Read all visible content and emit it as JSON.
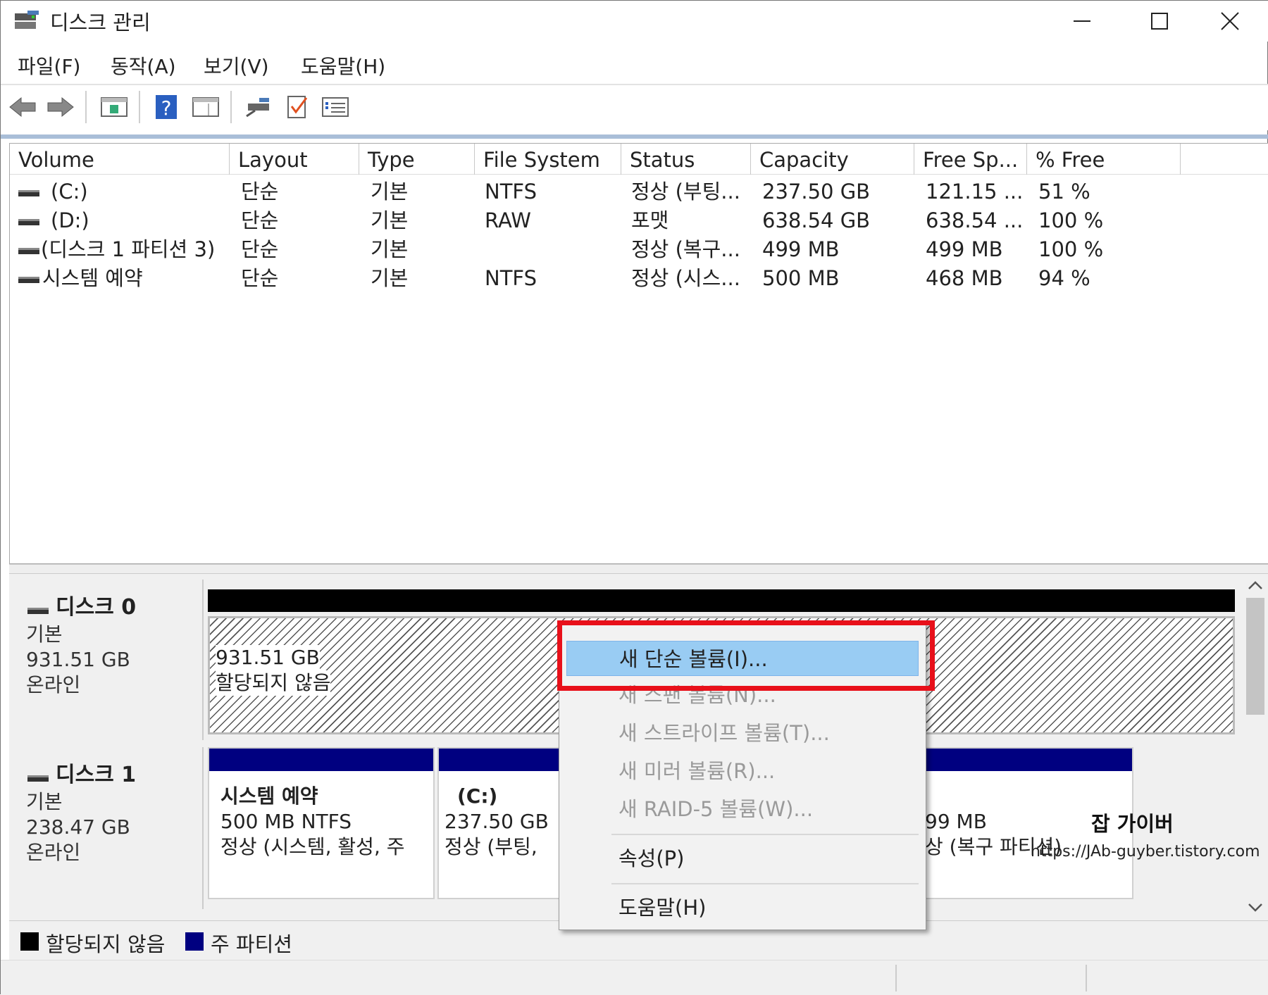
{
  "window": {
    "title": "디스크 관리"
  },
  "menubar": [
    "파일(F)",
    "동작(A)",
    "보기(V)",
    "도움말(H)"
  ],
  "volume_table": {
    "columns": [
      "Volume",
      "Layout",
      "Type",
      "File System",
      "Status",
      "Capacity",
      "Free Sp...",
      "% Free"
    ],
    "rows": [
      {
        "volume": "(C:)",
        "layout": "단순",
        "type": "기본",
        "fs": "NTFS",
        "status": "정상 (부팅...",
        "capacity": "237.50 GB",
        "free": "121.15 ...",
        "pct": "51 %"
      },
      {
        "volume": "(D:)",
        "layout": "단순",
        "type": "기본",
        "fs": "RAW",
        "status": "포맷",
        "capacity": "638.54 GB",
        "free": "638.54 ...",
        "pct": "100 %"
      },
      {
        "volume": "(디스크 1 파티션 3)",
        "layout": "단순",
        "type": "기본",
        "fs": "",
        "status": "정상 (복구...",
        "capacity": "499 MB",
        "free": "499 MB",
        "pct": "100 %"
      },
      {
        "volume": "시스템 예약",
        "layout": "단순",
        "type": "기본",
        "fs": "NTFS",
        "status": "정상 (시스...",
        "capacity": "500 MB",
        "free": "468 MB",
        "pct": "94 %"
      }
    ]
  },
  "disks": [
    {
      "name": "디스크 0",
      "type": "기본",
      "size": "931.51 GB",
      "state": "온라인",
      "partitions": [
        {
          "size": "931.51 GB",
          "desc": "할당되지 않음"
        }
      ]
    },
    {
      "name": "디스크 1",
      "type": "기본",
      "size": "238.47 GB",
      "state": "온라인",
      "partitions": [
        {
          "name": "시스템 예약",
          "size": "500 MB NTFS",
          "desc": "정상 (시스템, 활성, 주"
        },
        {
          "name": "(C:)",
          "size": "237.50 GB",
          "desc": "정상 (부팅,"
        },
        {
          "size": "99 MB",
          "desc": "상 (복구 파티션)"
        }
      ]
    }
  ],
  "legend": [
    {
      "label": "할당되지 않음",
      "color": "#000000"
    },
    {
      "label": "주 파티션",
      "color": "#000080"
    }
  ],
  "context_menu": {
    "items": [
      {
        "label": "새 단순 볼륨(I)...",
        "enabled": true,
        "highlighted": true
      },
      {
        "label": "새 스팬 볼륨(N)...",
        "enabled": false
      },
      {
        "label": "새 스트라이프 볼륨(T)...",
        "enabled": false
      },
      {
        "label": "새 미러 볼륨(R)...",
        "enabled": false
      },
      {
        "label": "새 RAID-5 볼륨(W)...",
        "enabled": false
      },
      {
        "label": "속성(P)",
        "enabled": true
      },
      {
        "label": "도움말(H)",
        "enabled": true
      }
    ]
  },
  "watermark": {
    "name": "잡 가이버",
    "url": "https://JAb-guyber.tistory.com"
  },
  "colors": {
    "highlight": "#99ccf3",
    "primary_partition": "#000080",
    "unallocated": "#000000",
    "annotation": "#e8101a"
  }
}
